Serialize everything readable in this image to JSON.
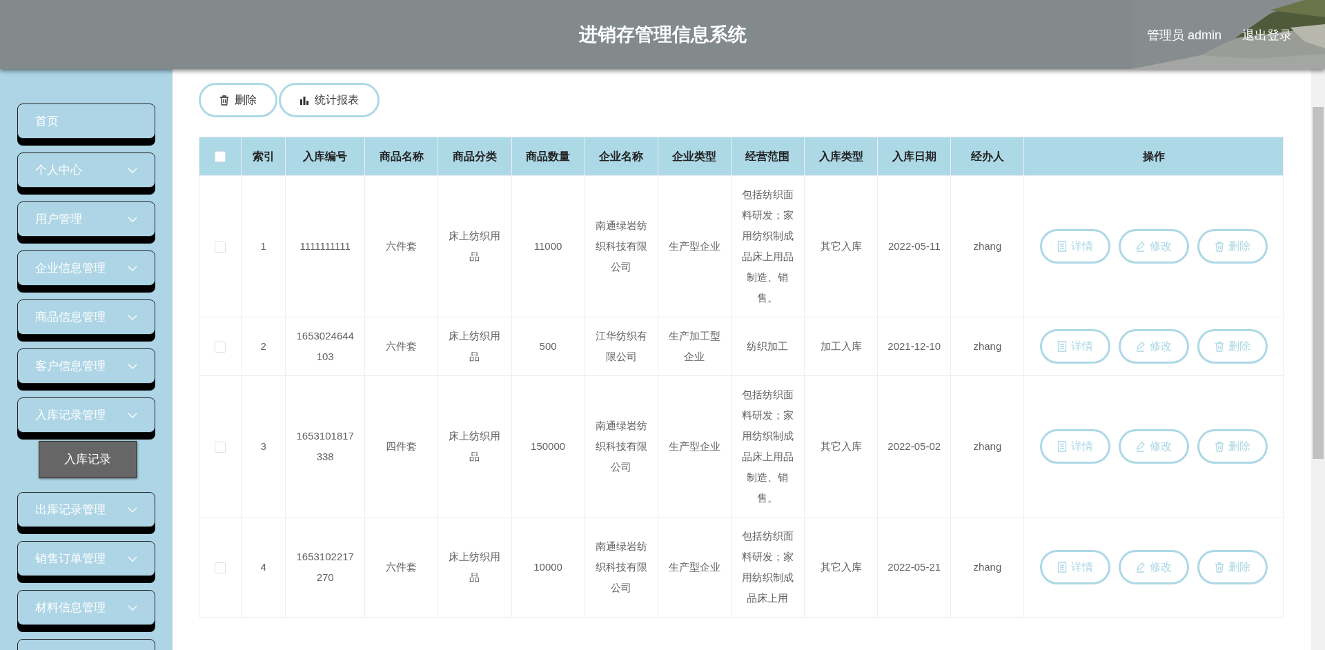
{
  "header": {
    "title": "进销存管理信息系统",
    "user": "管理员 admin",
    "logout": "退出登录"
  },
  "sidebar": {
    "items": [
      {
        "label": "首页",
        "kind": "link"
      },
      {
        "label": "个人中心",
        "kind": "menu"
      },
      {
        "label": "用户管理",
        "kind": "menu"
      },
      {
        "label": "企业信息管理",
        "kind": "menu"
      },
      {
        "label": "商品信息管理",
        "kind": "menu"
      },
      {
        "label": "客户信息管理",
        "kind": "menu"
      },
      {
        "label": "入库记录管理",
        "kind": "menu",
        "children": [
          {
            "label": "入库记录"
          }
        ]
      },
      {
        "label": "出库记录管理",
        "kind": "menu"
      },
      {
        "label": "销售订单管理",
        "kind": "menu"
      },
      {
        "label": "材料信息管理",
        "kind": "menu"
      },
      {
        "kind": "menu"
      }
    ]
  },
  "toolbar": {
    "buttons": [
      {
        "label": "删除",
        "kind": "delete"
      },
      {
        "label": "统计报表",
        "kind": "chart"
      }
    ]
  },
  "table": {
    "select_all": {
      "checked": false
    },
    "columns": [
      "索引",
      "入库编号",
      "商品名称",
      "商品分类",
      "商品数量",
      "企业名称",
      "企业类型",
      "经营范围",
      "入库类型",
      "入库日期",
      "经办人",
      "操作"
    ],
    "rows": [
      {
        "checked": false,
        "cells": [
          "1",
          "1111111111",
          "六件套",
          "床上纺织用品",
          "11000",
          "南通绿岩纺织科技有限公司",
          "生产型企业",
          "包括纺织面料研发；家用纺织制成品床上用品制造、销售。",
          "其它入库",
          "2022-05-11",
          "zhang"
        ],
        "actions": [
          {
            "label": "详情",
            "kind": "detail"
          },
          {
            "label": "修改",
            "kind": "edit"
          },
          {
            "label": "删除",
            "kind": "delete"
          }
        ]
      },
      {
        "checked": false,
        "cells": [
          "2",
          "1653024644103",
          "六件套",
          "床上纺织用品",
          "500",
          "江华纺织有限公司",
          "生产加工型企业",
          "纺织加工",
          "加工入库",
          "2021-12-10",
          "zhang"
        ],
        "actions": [
          {
            "label": "详情",
            "kind": "detail"
          },
          {
            "label": "修改",
            "kind": "edit"
          },
          {
            "label": "删除",
            "kind": "delete"
          }
        ]
      },
      {
        "checked": false,
        "cells": [
          "3",
          "1653101817338",
          "四件套",
          "床上纺织用品",
          "150000",
          "南通绿岩纺织科技有限公司",
          "生产型企业",
          "包括纺织面料研发；家用纺织制成品床上用品制造、销售。",
          "其它入库",
          "2022-05-02",
          "zhang"
        ],
        "actions": [
          {
            "label": "详情",
            "kind": "detail"
          },
          {
            "label": "修改",
            "kind": "edit"
          },
          {
            "label": "删除",
            "kind": "delete"
          }
        ]
      },
      {
        "checked": false,
        "cells": [
          "4",
          "1653102217270",
          "六件套",
          "床上纺织用品",
          "10000",
          "南通绿岩纺织科技有限公司",
          "生产型企业",
          "包括纺织面料研发；家用纺织制成品床上用",
          "其它入库",
          "2022-05-21",
          "zhang"
        ],
        "actions": [
          {
            "label": "详情",
            "kind": "detail"
          },
          {
            "label": "修改",
            "kind": "edit"
          },
          {
            "label": "删除",
            "kind": "delete"
          }
        ]
      }
    ]
  }
}
